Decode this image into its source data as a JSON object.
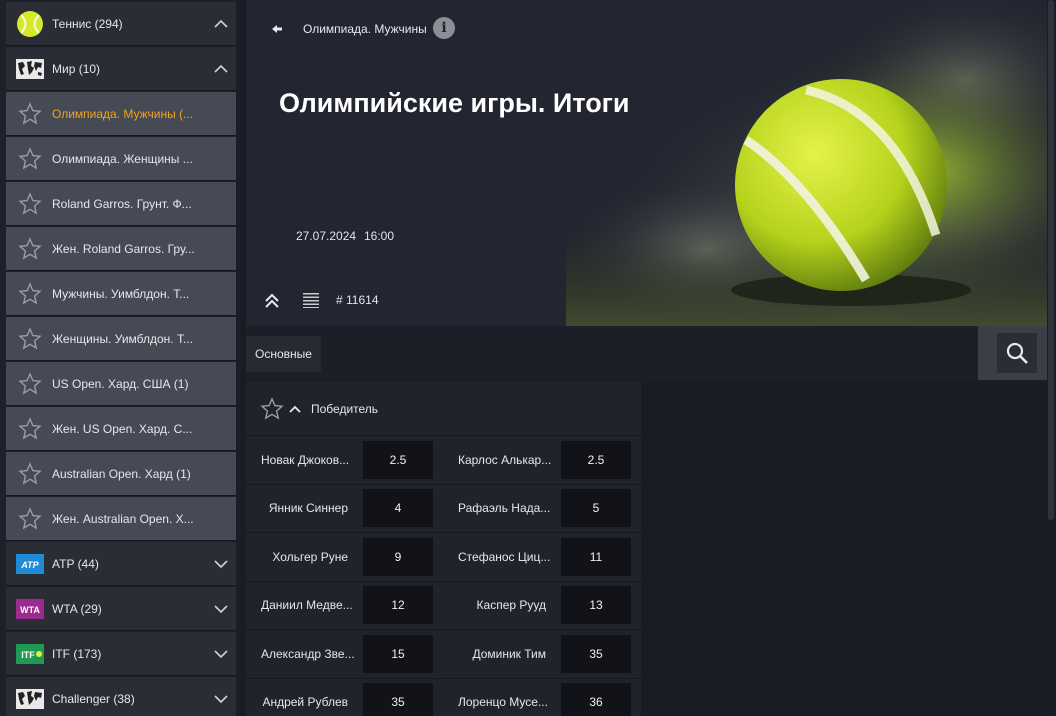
{
  "sidebar": {
    "sport": {
      "label": "Теннис (294)",
      "icon": "tennis-ball-icon"
    },
    "group": {
      "label": "Мир (10)",
      "icon": "world-map-icon"
    },
    "tournaments": [
      {
        "label": "Олимпиада. Мужчины (...",
        "active": true
      },
      {
        "label": "Олимпиада. Женщины ...",
        "active": false
      },
      {
        "label": "Roland Garros. Грунт. Ф...",
        "active": false
      },
      {
        "label": "Жен. Roland Garros. Гру...",
        "active": false
      },
      {
        "label": "Мужчины. Уимблдон. Т...",
        "active": false
      },
      {
        "label": "Женщины. Уимблдон. Т...",
        "active": false
      },
      {
        "label": "US Open. Хард. США (1)",
        "active": false
      },
      {
        "label": "Жен. US Open. Хард. С...",
        "active": false
      },
      {
        "label": "Australian Open. Хард (1)",
        "active": false
      },
      {
        "label": "Жен. Australian Open. Х...",
        "active": false
      }
    ],
    "categories": [
      {
        "label": "ATP (44)",
        "logo_text": "ATP"
      },
      {
        "label": "WTA (29)",
        "logo_text": "WTA"
      },
      {
        "label": "ITF (173)",
        "logo_text": "ITF"
      },
      {
        "label": "Challenger (38)",
        "logo_text": ""
      }
    ]
  },
  "hero": {
    "breadcrumb": "Олимпиада. Мужчины",
    "title": "Олимпийские игры. Итоги",
    "date": "27.07.2024",
    "time": "16:00",
    "event_id": "# 11614"
  },
  "tabs": {
    "main": "Основные"
  },
  "market": {
    "title": "Победитель",
    "rows": [
      {
        "p1": "Новак Джоков...",
        "o1": "2.5",
        "p2": "Карлос Алькар...",
        "o2": "2.5"
      },
      {
        "p1": "Янник Синнер",
        "o1": "4",
        "p2": "Рафаэль Нада...",
        "o2": "5"
      },
      {
        "p1": "Хольгер Руне",
        "o1": "9",
        "p2": "Стефанос Циц...",
        "o2": "11"
      },
      {
        "p1": "Даниил Медве...",
        "o1": "12",
        "p2": "Каспер Рууд",
        "o2": "13"
      },
      {
        "p1": "Александр Зве...",
        "o1": "15",
        "p2": "Доминик Тим",
        "o2": "35"
      },
      {
        "p1": "Андрей Рублев",
        "o1": "35",
        "p2": "Лоренцо Мусе...",
        "o2": "36"
      }
    ]
  },
  "colors": {
    "accent": "#f3a31c",
    "ball": "#c8e02a",
    "background": "#191c25"
  }
}
